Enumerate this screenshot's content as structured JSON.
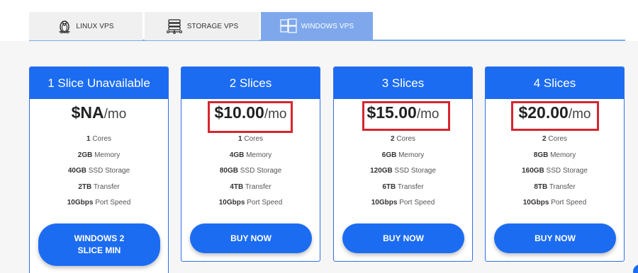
{
  "tabs": [
    {
      "label": "LINUX VPS",
      "icon": "linux-penguin-icon",
      "active": false
    },
    {
      "label": "STORAGE VPS",
      "icon": "storage-server-icon",
      "active": false
    },
    {
      "label": "WINDOWS VPS",
      "icon": "windows-logo-icon",
      "active": true
    }
  ],
  "plans": [
    {
      "title": "1 Slice Unavailable",
      "price": "$NA",
      "unit": "/mo",
      "specs": [
        {
          "value": "1",
          "label": " Cores"
        },
        {
          "value": "2GB",
          "label": " Memory"
        },
        {
          "value": "40GB",
          "label": " SSD Storage"
        },
        {
          "value": "2TB",
          "label": " Transfer"
        },
        {
          "value": "10Gbps",
          "label": " Port Speed"
        }
      ],
      "button": "WINDOWS 2 SLICE MIN"
    },
    {
      "title": "2 Slices",
      "price": "$10.00",
      "unit": "/mo",
      "specs": [
        {
          "value": "1",
          "label": " Cores"
        },
        {
          "value": "4GB",
          "label": " Memory"
        },
        {
          "value": "80GB",
          "label": " SSD Storage"
        },
        {
          "value": "4TB",
          "label": " Transfer"
        },
        {
          "value": "10Gbps",
          "label": " Port Speed"
        }
      ],
      "button": "BUY NOW"
    },
    {
      "title": "3 Slices",
      "price": "$15.00",
      "unit": "/mo",
      "specs": [
        {
          "value": "2",
          "label": " Cores"
        },
        {
          "value": "6GB",
          "label": " Memory"
        },
        {
          "value": "120GB",
          "label": " SSD Storage"
        },
        {
          "value": "6TB",
          "label": " Transfer"
        },
        {
          "value": "10Gbps",
          "label": " Port Speed"
        }
      ],
      "button": "BUY NOW"
    },
    {
      "title": "4 Slices",
      "price": "$20.00",
      "unit": "/mo",
      "specs": [
        {
          "value": "2",
          "label": " Cores"
        },
        {
          "value": "8GB",
          "label": " Memory"
        },
        {
          "value": "160GB",
          "label": " SSD Storage"
        },
        {
          "value": "8TB",
          "label": " Transfer"
        },
        {
          "value": "10Gbps",
          "label": " Port Speed"
        }
      ],
      "button": "BUY NOW"
    }
  ],
  "colors": {
    "accent": "#1c6cf1",
    "active_tab": "#7fa8ec",
    "highlight": "#d6262f"
  }
}
